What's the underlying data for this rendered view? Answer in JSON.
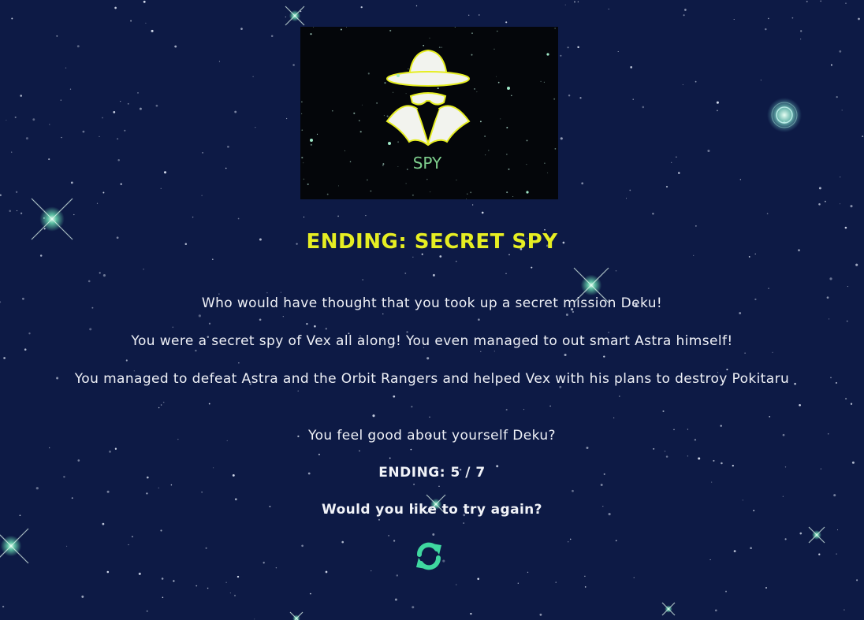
{
  "image": {
    "label": "SPY",
    "icon": "spy-hat-icon"
  },
  "ending": {
    "title": "ENDING: SECRET SPY",
    "paragraphs": [
      "Who would have thought that you took up a secret mission Deku!",
      "You were a secret spy of Vex all along! You even managed to out smart Astra himself!",
      "You managed to defeat Astra and the Orbit Rangers and helped Vex with his plans to destroy Pokitaru",
      "You feel good about yourself Deku?"
    ],
    "count": "ENDING: 5 / 7",
    "prompt": "Would you like to try again?"
  },
  "restart": {
    "icon": "restart-icon"
  },
  "colors": {
    "background": "#0d1a45",
    "title": "#e6ee22",
    "text": "#eef0f6",
    "restart": "#3fd8a0",
    "image_label": "#7fd08e"
  }
}
